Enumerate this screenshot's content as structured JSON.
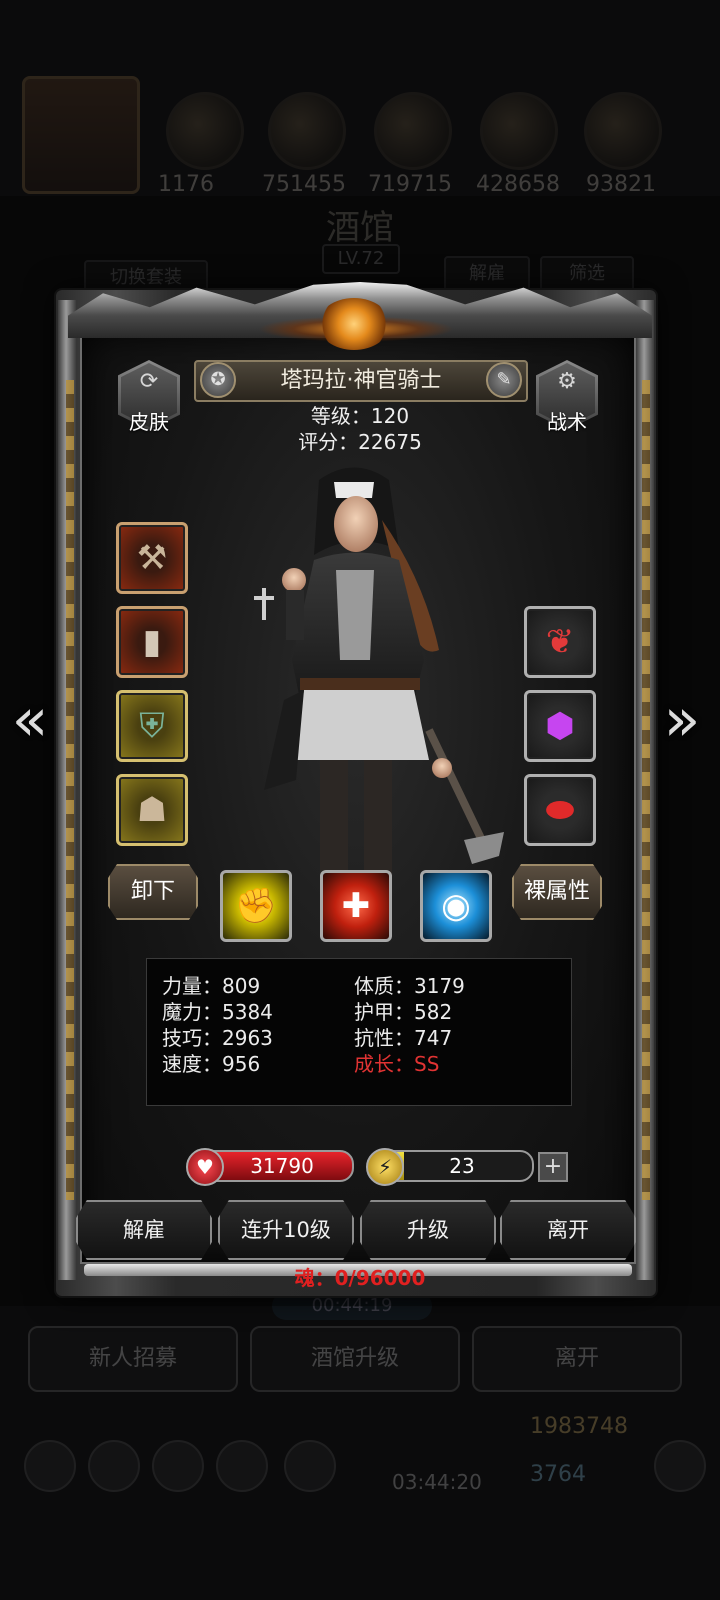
{
  "background": {
    "resource_counts": [
      "1176",
      "751455",
      "719715",
      "428658",
      "93821"
    ],
    "title": "酒馆",
    "level": "LV.72",
    "switch_outfit_label": "切换套装",
    "dismiss_label": "解雇",
    "filter_label": "筛选",
    "timer": "00:44:19",
    "buttons": [
      "新人招募",
      "酒馆升级",
      "离开"
    ],
    "gold": "1983748",
    "gems": "3764",
    "chest_timer": "03:44:20"
  },
  "hero": {
    "name": "塔玛拉·神官骑士",
    "level_text": "等级：120",
    "score_text": "评分：22675",
    "skin_label": "皮肤",
    "tactics_label": "战术",
    "unequip_label": "卸下",
    "naked_attr_label": "裸属性"
  },
  "equipment": {
    "left": [
      {
        "icon": "mace-icon",
        "frame": "red"
      },
      {
        "icon": "armor-icon",
        "frame": "red"
      },
      {
        "icon": "shield-icon",
        "frame": "gold"
      },
      {
        "icon": "mask-icon",
        "frame": "gold"
      }
    ],
    "right": [
      {
        "icon": "amulet-icon",
        "frame": "plain"
      },
      {
        "icon": "purple-gem-icon",
        "frame": "plain"
      },
      {
        "icon": "red-stone-icon",
        "frame": "plain"
      }
    ]
  },
  "skills": [
    {
      "icon": "fist-icon",
      "color": "#f5e100"
    },
    {
      "icon": "heal-cross-icon",
      "color": "#e8321e"
    },
    {
      "icon": "eye-icon",
      "color": "#2aa8f2"
    }
  ],
  "attributes": {
    "strength": "力量：809",
    "magic": "魔力：5384",
    "skill": "技巧：2963",
    "speed": "速度：956",
    "constitution": "体质：3179",
    "armor": "护甲：582",
    "resistance": "抗性：747",
    "growth": "成长：SS",
    "growth_color": "#e13333"
  },
  "bars": {
    "hp": "31790",
    "energy": "23",
    "energy_fraction": 0.2
  },
  "actions": {
    "dismiss": "解雇",
    "upgrade10": "连升10级",
    "upgrade": "升级",
    "leave": "离开"
  },
  "soul_text": "魂：0/96000"
}
